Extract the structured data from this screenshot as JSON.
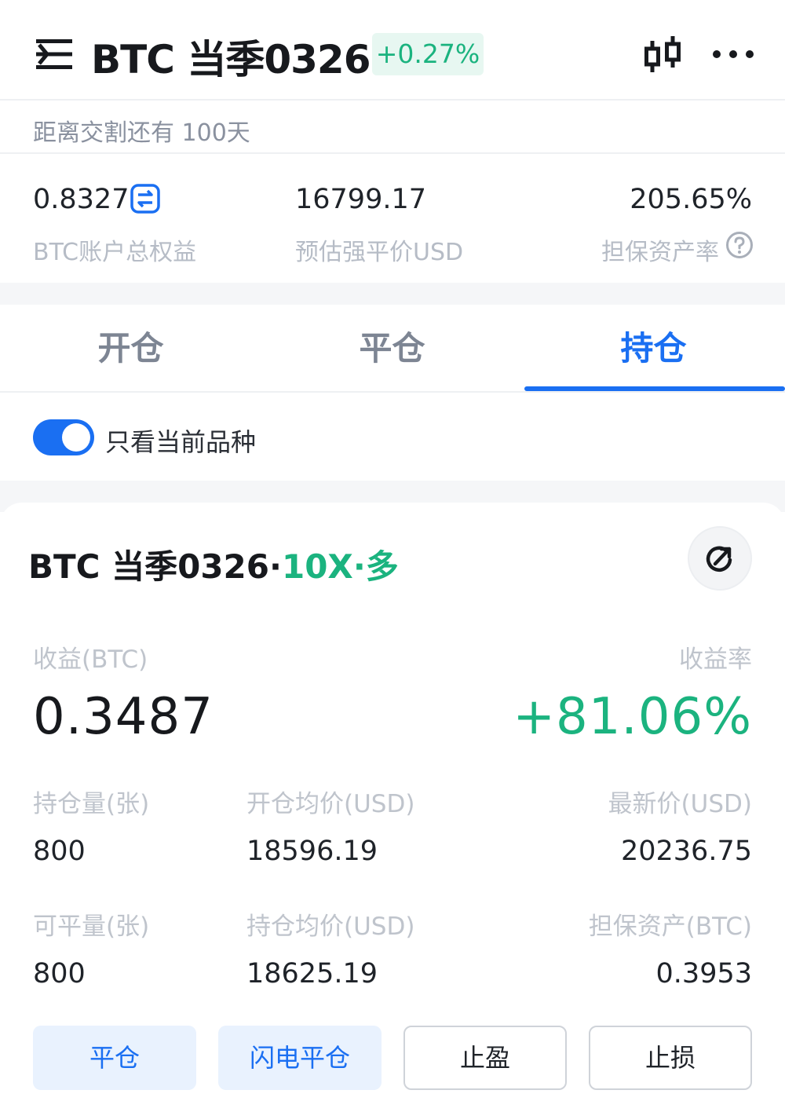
{
  "header": {
    "title": "BTC 当季0326",
    "change": "+0.27%",
    "colors": {
      "up": "#1bb37f",
      "accent": "#1a6ff2"
    }
  },
  "delivery": {
    "text": "距离交割还有 100天"
  },
  "stats": [
    {
      "value": "0.8327",
      "label": "BTC账户总权益"
    },
    {
      "value": "16799.17",
      "label": "预估强平价USD"
    },
    {
      "value": "205.65%",
      "label": "担保资产率"
    }
  ],
  "tabs": [
    {
      "label": "开仓",
      "active": false
    },
    {
      "label": "平仓",
      "active": false
    },
    {
      "label": "持仓",
      "active": true
    }
  ],
  "filter": {
    "label": "只看当前品种",
    "enabled": true
  },
  "position": {
    "name": "BTC 当季0326",
    "leverage": "10X",
    "direction": "多",
    "sep": "·",
    "pnl_label": "收益(BTC)",
    "pnl_value": "0.3487",
    "rate_label": "收益率",
    "rate_value": "+81.06%",
    "fields": [
      {
        "label": "持仓量(张)",
        "value": "800"
      },
      {
        "label": "开仓均价(USD)",
        "value": "18596.19"
      },
      {
        "label": "最新价(USD)",
        "value": "20236.75"
      },
      {
        "label": "可平量(张)",
        "value": "800"
      },
      {
        "label": "持仓均价(USD)",
        "value": "18625.19"
      },
      {
        "label": "担保资产(BTC)",
        "value": "0.3953"
      }
    ]
  },
  "actions": [
    {
      "label": "平仓"
    },
    {
      "label": "闪电平仓"
    },
    {
      "label": "止盈"
    },
    {
      "label": "止损"
    }
  ]
}
